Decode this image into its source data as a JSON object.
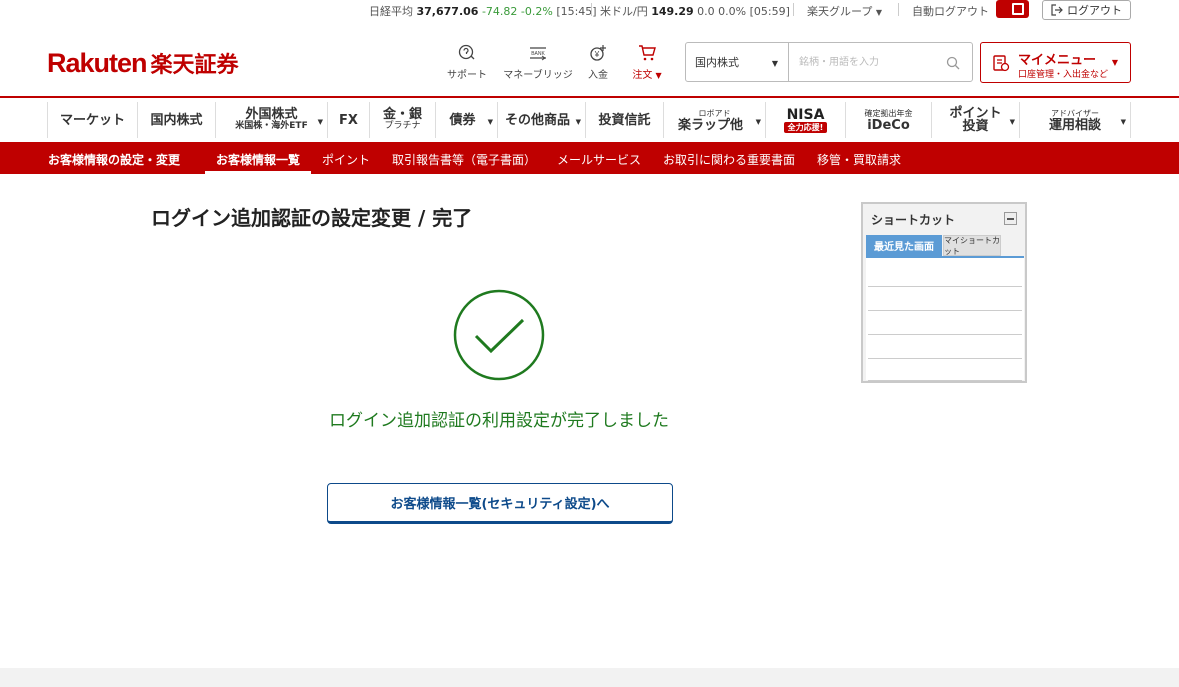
{
  "ticker": {
    "nikkei_label": "日経平均",
    "nikkei_value": "37,677.06",
    "nikkei_change": "-74.82 -0.2%",
    "nikkei_time": "[15:45]",
    "usdjpy_label": "米ドル/円",
    "usdjpy_value": "149.29",
    "usdjpy_change": "0.0 0.0%",
    "usdjpy_time": "[05:59]",
    "group_label": "楽天グループ",
    "auto_logout_label": "自動ログアウト",
    "logout_label": "ログアウト"
  },
  "header": {
    "logo_en": "Rakuten",
    "logo_jp": "楽天証券",
    "icons": [
      {
        "label": "サポート",
        "icon": "support-icon"
      },
      {
        "label": "マネーブリッジ",
        "icon": "bank-icon"
      },
      {
        "label": "入金",
        "icon": "deposit-icon"
      },
      {
        "label": "注文",
        "icon": "cart-icon"
      }
    ],
    "search_category": "国内株式",
    "search_placeholder": "銘柄・用語を入力",
    "mymenu_title": "マイメニュー",
    "mymenu_sub": "口座管理・入出金など"
  },
  "global_nav": [
    {
      "label": "マーケット"
    },
    {
      "label": "国内株式"
    },
    {
      "label": "外国株式",
      "sub": "米国株・海外ETF"
    },
    {
      "label": "FX"
    },
    {
      "label": "金・銀",
      "sub": "プラチナ"
    },
    {
      "label": "債券"
    },
    {
      "label": "その他商品"
    },
    {
      "label": "投資信託"
    },
    {
      "top": "ロボアド",
      "label": "楽ラップ他"
    },
    {
      "label": "NISA",
      "badge": "全力応援!"
    },
    {
      "top": "確定拠出年金",
      "label": "iDeCo"
    },
    {
      "label": "ポイント",
      "sub2": "投資"
    },
    {
      "top": "アドバイザー",
      "label": "運用相談"
    }
  ],
  "sub_nav": {
    "section": "お客様情報の設定・変更",
    "items": [
      "お客様情報一覧",
      "ポイント",
      "取引報告書等（電子書面）",
      "メールサービス",
      "お取引に関わる重要書面",
      "移管・買取請求"
    ]
  },
  "main": {
    "title": "ログイン追加認証の設定変更 / 完了",
    "message": "ログイン追加認証の利用設定が完了しました",
    "button_label": "お客様情報一覧(セキュリティ設定)へ"
  },
  "shortcut": {
    "title": "ショートカット",
    "tab_recent": "最近見た画面",
    "tab_my": "マイショートカット"
  },
  "colors": {
    "brand": "#bf0000",
    "success": "#1f7a1f",
    "button_border": "#0d4a8a",
    "tab_active": "#5b9bd5"
  }
}
